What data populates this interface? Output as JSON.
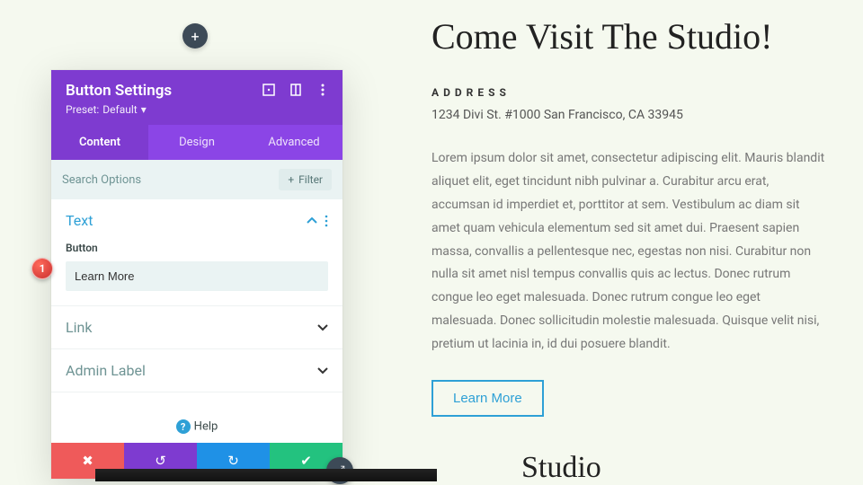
{
  "add_button_tooltip": "+",
  "panel": {
    "title": "Button Settings",
    "preset_prefix": "Preset:",
    "preset_value": "Default",
    "tabs": {
      "content": "Content",
      "design": "Design",
      "advanced": "Advanced"
    },
    "search_placeholder": "Search Options",
    "filter_label": "Filter",
    "sections": {
      "text": {
        "title": "Text",
        "field_label": "Button",
        "field_value": "Learn More"
      },
      "link": {
        "title": "Link"
      },
      "admin_label": {
        "title": "Admin Label"
      }
    },
    "help_label": "Help"
  },
  "callout": {
    "number": "1"
  },
  "page": {
    "heading": "Come Visit The Studio!",
    "address_label": "ADDRESS",
    "address_value": "1234 Divi St. #1000 San Francisco, CA 33945",
    "body": "Lorem ipsum dolor sit amet, consectetur adipiscing elit. Mauris blandit aliquet elit, eget tincidunt nibh pulvinar a. Curabitur arcu erat, accumsan id imperdiet et, porttitor at sem. Vestibulum ac diam sit amet quam vehicula elementum sed sit amet dui. Praesent sapien massa, convallis a pellentesque nec, egestas non nisi. Curabitur non nulla sit amet nisl tempus convallis quis ac lectus. Donec rutrum congue leo eget malesuada. Donec rutrum congue leo eget malesuada. Donec sollicitudin molestie malesuada. Quisque velit nisi, pretium ut lacinia in, id dui posuere blandit.",
    "cta_label": "Learn More",
    "peek_heading": "Studio"
  }
}
